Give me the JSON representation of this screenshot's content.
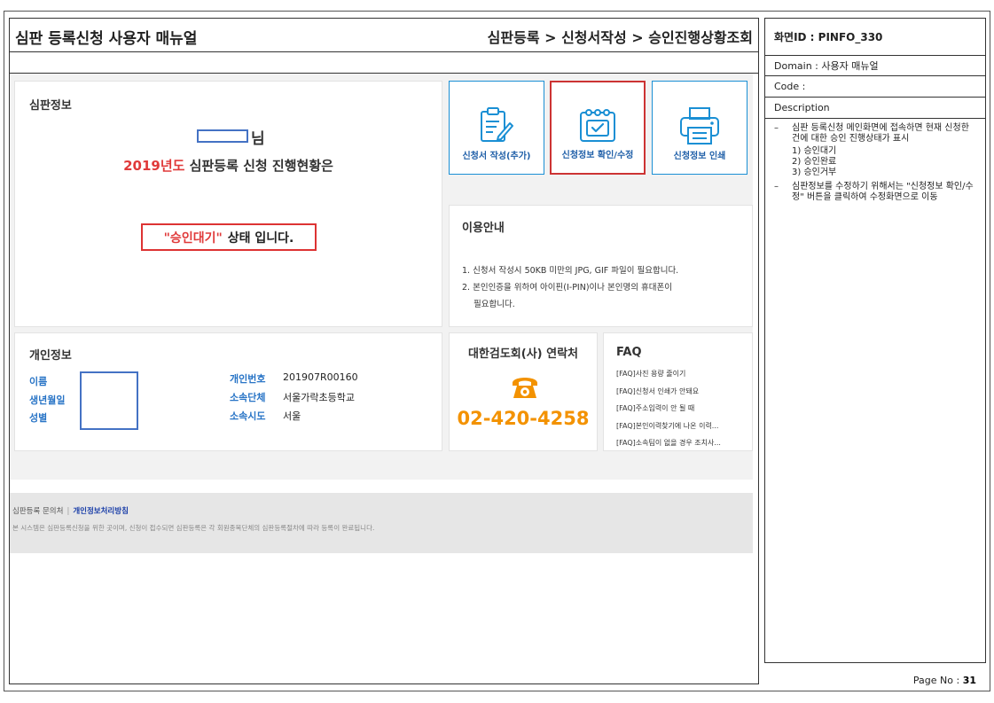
{
  "header": {
    "doc_title": "심판 등록신청 사용자 매뉴얼",
    "nav_path": "심판등록 > 신청서작성 > 승인진행상황조회"
  },
  "referee_info": {
    "title": "심판정보",
    "name_suffix": "님",
    "year_highlight": "2019년도",
    "year_rest": "심판등록 신청 진행현황은",
    "status_quote": "\"승인대기\"",
    "status_rest": "상태 입니다."
  },
  "tiles": [
    {
      "label": "신청서 작성(추가)",
      "icon": "form-edit-icon"
    },
    {
      "label": "신청정보 확인/수정",
      "icon": "calendar-check-icon"
    },
    {
      "label": "신청정보 인쇄",
      "icon": "printer-icon"
    }
  ],
  "usage_guide": {
    "title": "이용안내",
    "line1": "1. 신청서 작성시 50KB 미만의 JPG, GIF 파일이 필요합니다.",
    "line2": "2. 본인인증을 위하여 아이핀(I-PIN)이나 본인명의 휴대폰이",
    "line3": "필요합니다."
  },
  "personal_info": {
    "title": "개인정보",
    "name_label": "이름",
    "birth_label": "생년월일",
    "gender_label": "성별",
    "id_label": "개인번호",
    "id_value": "201907R00160",
    "org_label": "소속단체",
    "org_value": "서울가락초등학교",
    "city_label": "소속시도",
    "city_value": "서울"
  },
  "contact": {
    "title": "대한검도회(사) 연락처",
    "phone": "02-420-4258"
  },
  "faq": {
    "title": "FAQ",
    "items": [
      "[FAQ]사진 용량 줄이기",
      "[FAQ]신청서 인쇄가 안돼요",
      "[FAQ]주소입력이 안 될 때",
      "[FAQ]본인이력찾기에 나온 이력...",
      "[FAQ]소속팀이 없을 경우 조치사..."
    ]
  },
  "footer": {
    "inquiry": "심판등록 문의처",
    "privacy": "개인정보처리방침",
    "notice": "본 시스템은 심판등록신청을 위한 곳이며, 신청이 접수되면 심판등록은 각 회원종목단체의 심판등록절차에 따라 등록이 완료됩니다."
  },
  "side": {
    "screen_id": "화면ID : PINFO_330",
    "domain": "Domain : 사용자 매뉴얼",
    "code": "Code :",
    "description_label": "Description",
    "desc1": "심판 등록신청 메인화면에 접속하면 현재 신청한 건에 대한 승인 진행상태가 표시",
    "sub1": "1) 승인대기",
    "sub2": "2) 승인완료",
    "sub3": "3) 승인거부",
    "desc2": "심판정보를 수정하기 위해서는 \"신청정보 확인/수정\" 버튼을 클릭하여 수정화면으로 이동",
    "dash": "–"
  },
  "page": {
    "label": "Page No :",
    "number": "31"
  }
}
